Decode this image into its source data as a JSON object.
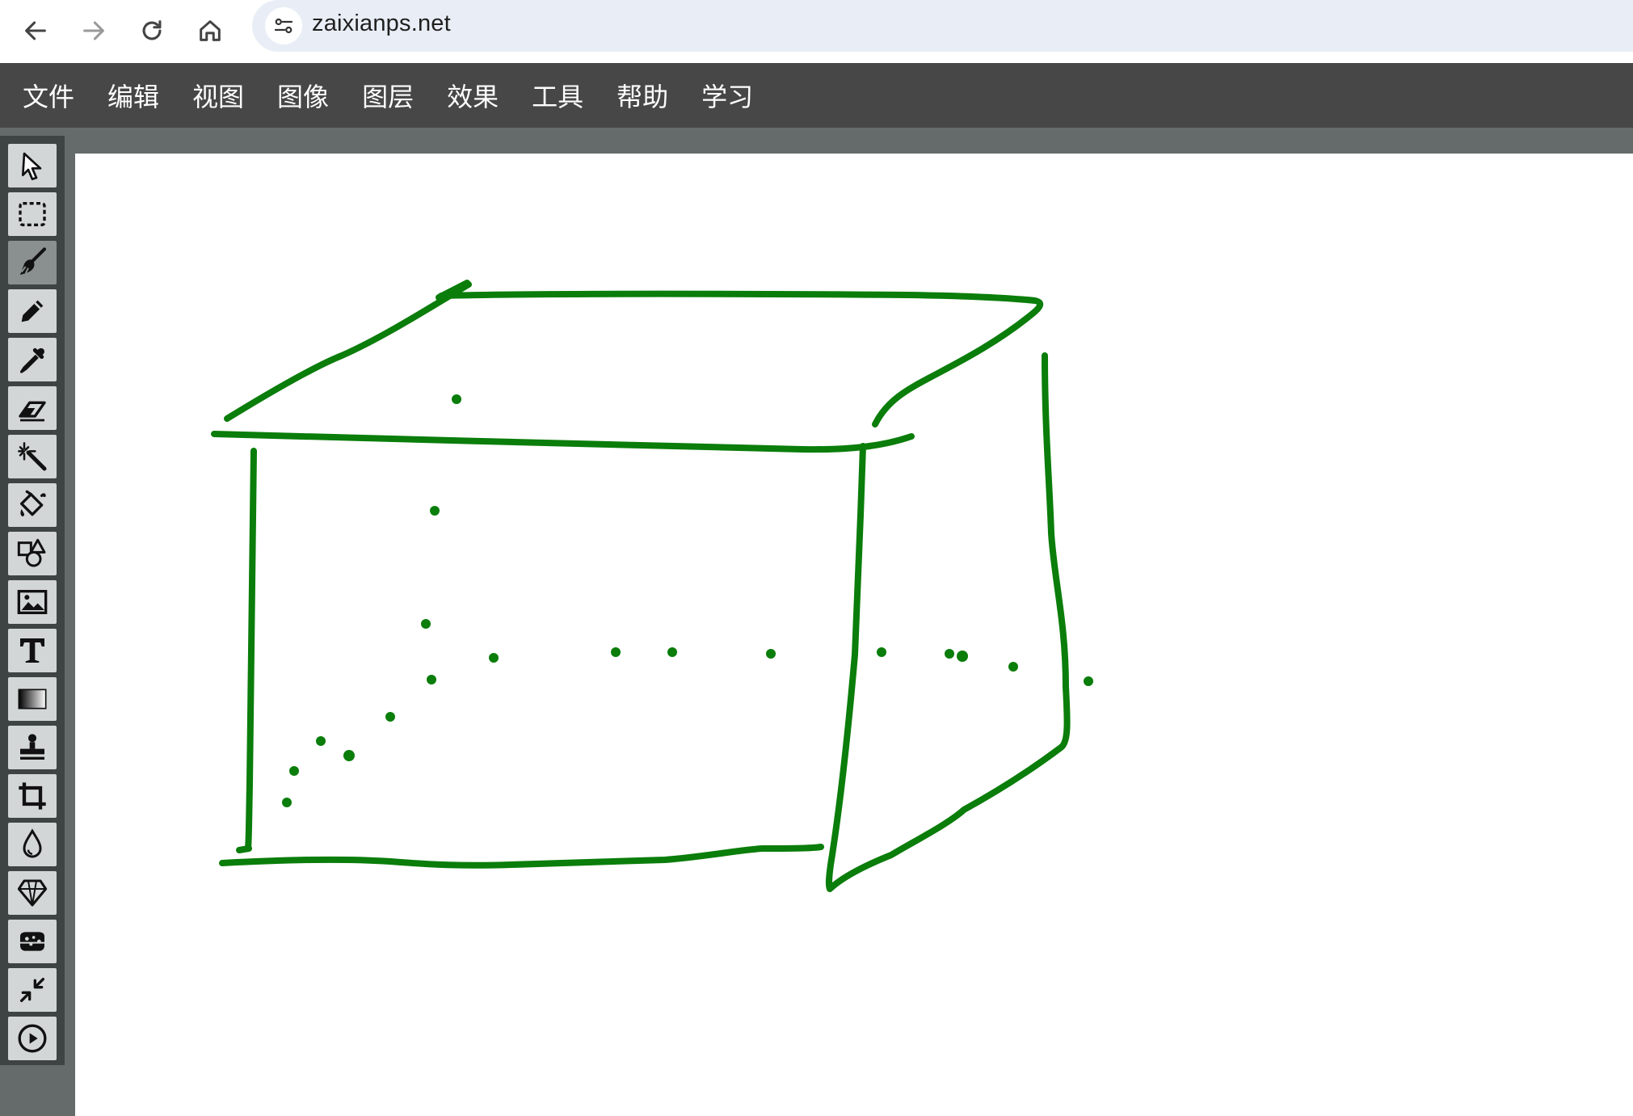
{
  "browser": {
    "url": "zaixianps.net",
    "icons": [
      "back-arrow-icon",
      "forward-arrow-icon",
      "reload-icon",
      "home-icon",
      "site-info-icon"
    ]
  },
  "menu": {
    "items": [
      "文件",
      "编辑",
      "视图",
      "图像",
      "图层",
      "效果",
      "工具",
      "帮助",
      "学习"
    ]
  },
  "toolbar": {
    "active_tool": "brush",
    "tools": [
      "move",
      "rect-select",
      "brush",
      "pencil",
      "eyedropper",
      "eraser",
      "magic-wand",
      "fill-bucket",
      "shapes",
      "image",
      "text",
      "gradient",
      "clone-stamp",
      "crop",
      "blur",
      "sharpen",
      "sponge",
      "resize",
      "play"
    ]
  },
  "canvas": {
    "stroke_color": "#0a7d0a",
    "content": "hand-drawn green box sketch with dotted hidden edges"
  },
  "colors": {
    "menu_bar": "#474747",
    "workspace": "#656b6b",
    "toolbar": "#3e4343",
    "address_bar": "#e9eef6"
  }
}
